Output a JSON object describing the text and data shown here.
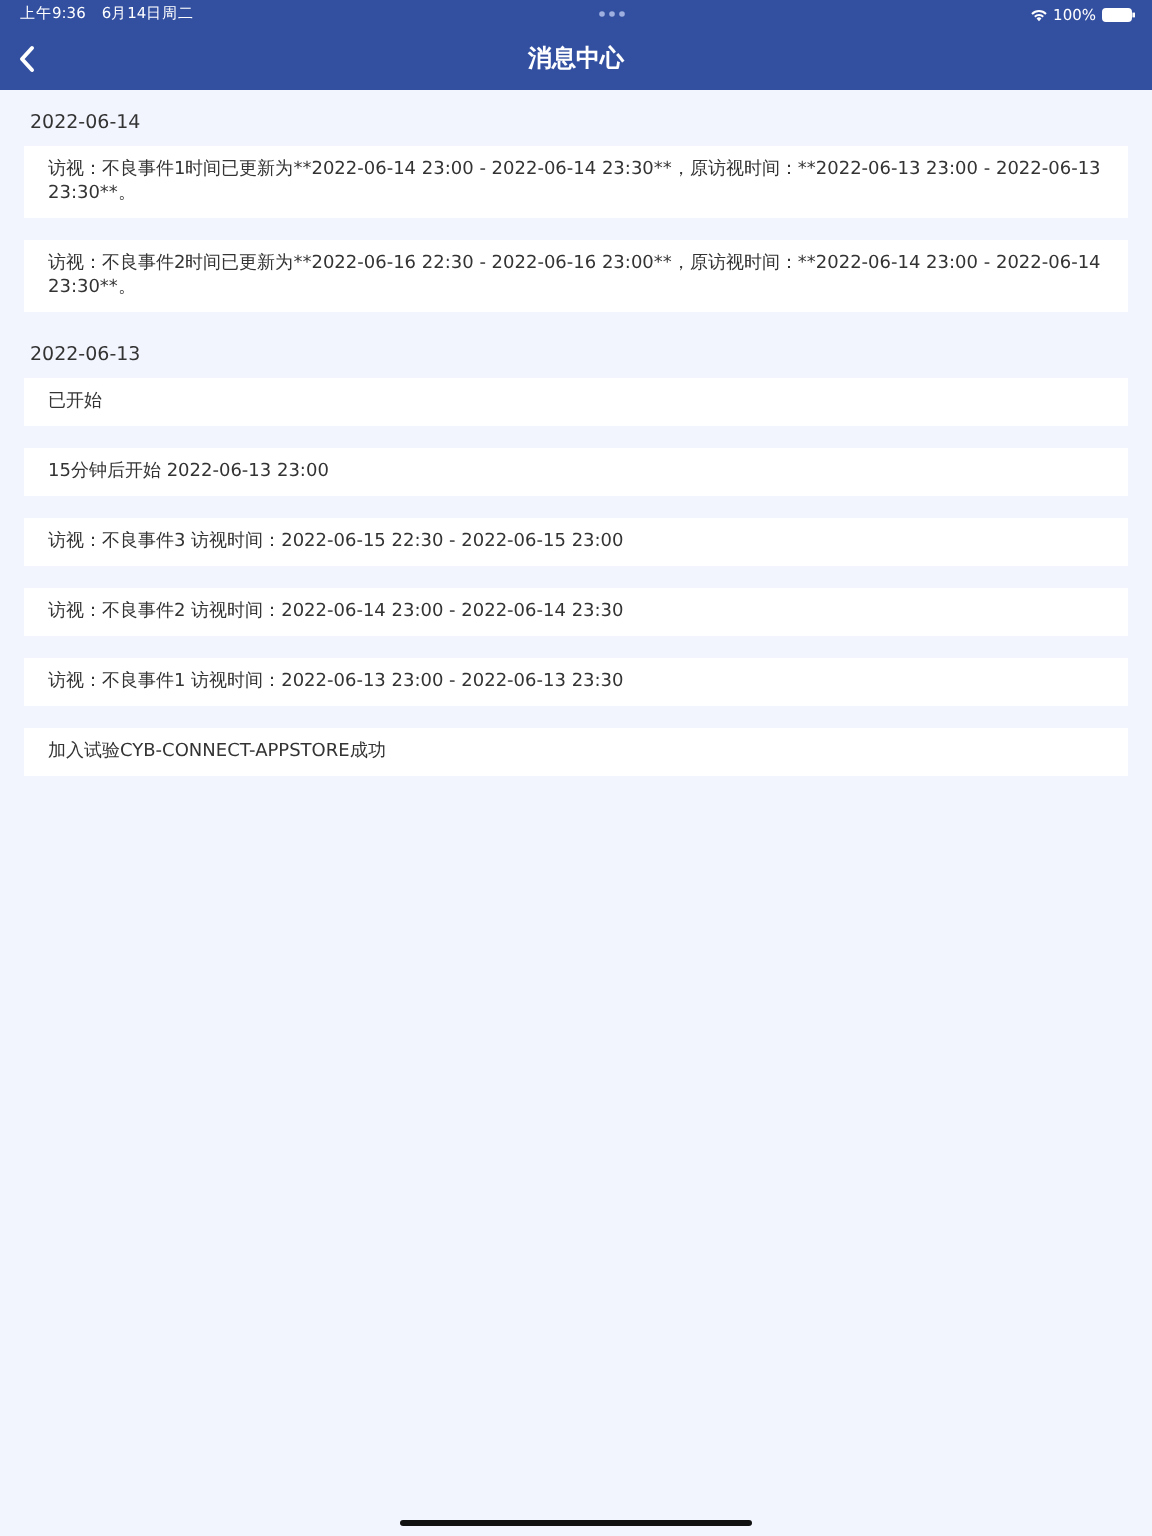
{
  "status_bar": {
    "time": "上午9:36",
    "date": "6月14日周二",
    "battery": "100%"
  },
  "nav_bar": {
    "title": "消息中心"
  },
  "groups": [
    {
      "date": "2022-06-14",
      "messages": [
        "访视：不良事件1时间已更新为**2022-06-14 23:00 - 2022-06-14 23:30**，原访视时间：**2022-06-13 23:00 - 2022-06-13 23:30**。",
        "访视：不良事件2时间已更新为**2022-06-16 22:30 - 2022-06-16 23:00**，原访视时间：**2022-06-14 23:00 - 2022-06-14 23:30**。"
      ]
    },
    {
      "date": "2022-06-13",
      "messages": [
        "已开始",
        "15分钟后开始 2022-06-13 23:00",
        "访视：不良事件3 访视时间：2022-06-15 22:30 - 2022-06-15 23:00",
        "访视：不良事件2 访视时间：2022-06-14 23:00 - 2022-06-14 23:30",
        "访视：不良事件1 访视时间：2022-06-13 23:00 - 2022-06-13 23:30",
        "加入试验CYB-CONNECT-APPSTORE成功"
      ]
    }
  ]
}
